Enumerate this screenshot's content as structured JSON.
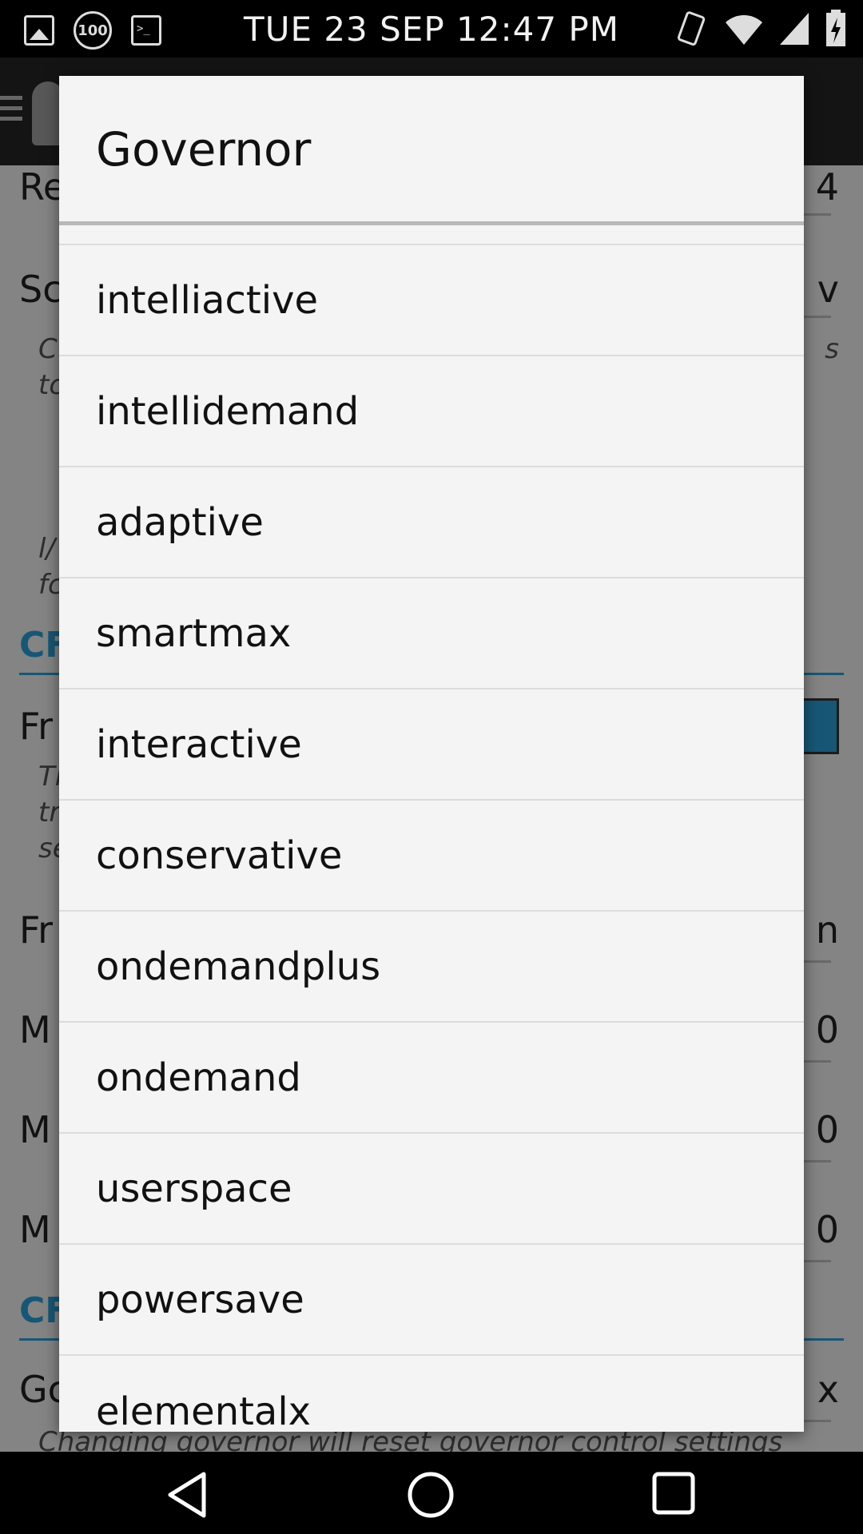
{
  "status_bar": {
    "time": "TUE 23 SEP 12:47 PM",
    "left_icons": [
      "image-icon",
      "battery-100-icon",
      "terminal-icon"
    ],
    "battery_saver_label": "100",
    "right_icons": [
      "vibrate-icon",
      "wifi-icon",
      "signal-icon",
      "battery-charging-icon"
    ]
  },
  "background": {
    "rows": [
      {
        "left": "Re",
        "right": "4"
      },
      {
        "left": "Sc",
        "right": "v"
      }
    ],
    "italic_lines": [
      "C",
      "tc",
      "l/",
      "fc"
    ],
    "italic_right": "s",
    "sections": [
      "CF",
      "CF"
    ],
    "rows2": [
      {
        "left": "Fr"
      },
      {
        "left": "Fr",
        "right": "n"
      },
      {
        "left": "M",
        "right": "0"
      },
      {
        "left": "M",
        "right": "0"
      },
      {
        "left": "M",
        "right": "0"
      },
      {
        "left": "Gc",
        "right": "x"
      }
    ],
    "italic_lines2": [
      "Ti",
      "tr",
      "se"
    ],
    "bottom_hint": "Changing governor will reset governor control settings"
  },
  "dialog": {
    "title": "Governor",
    "options": [
      "intelliactive",
      "intellidemand",
      "adaptive",
      "smartmax",
      "interactive",
      "conservative",
      "ondemandplus",
      "ondemand",
      "userspace",
      "powersave",
      "elementalx"
    ]
  },
  "nav_bar": {
    "buttons": [
      "back-icon",
      "home-icon",
      "recents-icon"
    ]
  },
  "colors": {
    "accent": "#2a9fd6",
    "dialog_bg": "#f4f4f4",
    "divider": "#dcdcdc"
  }
}
